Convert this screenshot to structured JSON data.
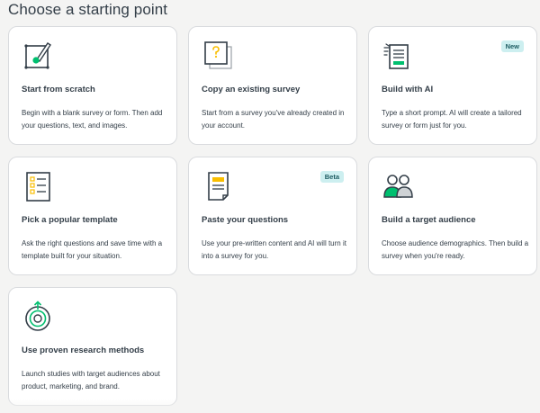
{
  "page": {
    "title": "Choose a starting point"
  },
  "cards": [
    {
      "title": "Start from scratch",
      "description": "Begin with a blank survey or form. Then add your questions, text, and images.",
      "icon": "pen-square-icon"
    },
    {
      "title": "Copy an existing survey",
      "description": "Start from a survey you've already created in your account.",
      "icon": "copy-document-icon"
    },
    {
      "title": "Build with AI",
      "description": "Type a short prompt. AI will create a tailored survey or form just for you.",
      "icon": "ai-form-icon",
      "badge": "New"
    },
    {
      "title": "Pick a popular template",
      "description": "Ask the right questions and save time with a template built for your situation.",
      "icon": "checklist-icon"
    },
    {
      "title": "Paste your questions",
      "description": "Use your pre-written content and AI will turn it into a survey for you.",
      "icon": "paste-document-icon",
      "badge": "Beta"
    },
    {
      "title": "Build a target audience",
      "description": "Choose audience demographics. Then build a survey when you're ready.",
      "icon": "people-icon"
    },
    {
      "title": "Use proven research methods",
      "description": "Launch studies with target audiences about product, marketing, and brand.",
      "icon": "target-cycle-icon"
    }
  ],
  "colors": {
    "accent_green": "#00bf6f",
    "badge_bg": "#cdeff0",
    "accent_yellow": "#f9be00",
    "border": "#d9dbde"
  }
}
